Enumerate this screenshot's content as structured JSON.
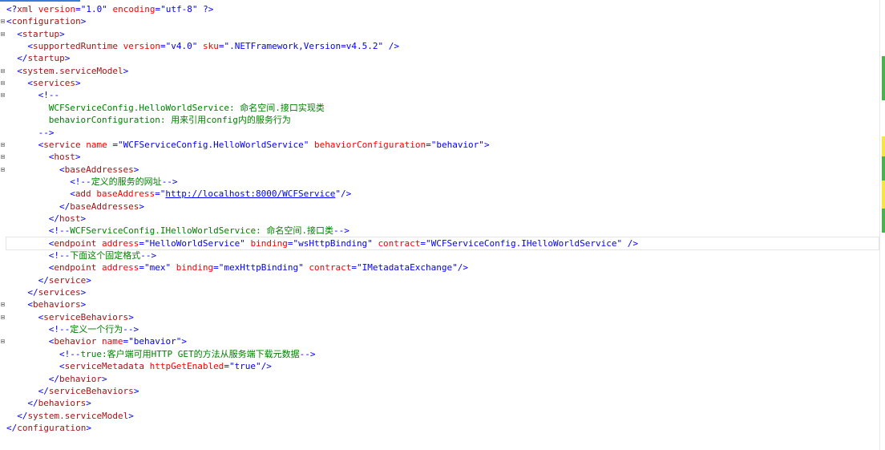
{
  "editor": {
    "language": "XML",
    "current_line": 20,
    "colors": {
      "bracket": "#0000ff",
      "element": "#a31515",
      "attribute": "#ff0000",
      "value": "#0000ff",
      "comment": "#008000",
      "change_mark_saved": "#4caf50",
      "change_mark_unsaved": "#f5e642"
    },
    "lines": [
      {
        "indent": 0,
        "fold": false,
        "tokens": [
          {
            "t": "bracket",
            "v": "<?"
          },
          {
            "t": "elem",
            "v": "xml"
          },
          {
            "t": "text",
            "v": " "
          },
          {
            "t": "attr",
            "v": "version"
          },
          {
            "t": "bracket",
            "v": "="
          },
          {
            "t": "val",
            "v": "\"1.0\""
          },
          {
            "t": "text",
            "v": " "
          },
          {
            "t": "attr",
            "v": "encoding"
          },
          {
            "t": "bracket",
            "v": "="
          },
          {
            "t": "val",
            "v": "\"utf-8\""
          },
          {
            "t": "text",
            "v": " "
          },
          {
            "t": "bracket",
            "v": "?>"
          }
        ]
      },
      {
        "indent": 0,
        "fold": true,
        "tokens": [
          {
            "t": "bracket",
            "v": "<"
          },
          {
            "t": "elem",
            "v": "configuration"
          },
          {
            "t": "bracket",
            "v": ">"
          }
        ]
      },
      {
        "indent": 1,
        "fold": true,
        "tokens": [
          {
            "t": "bracket",
            "v": "<"
          },
          {
            "t": "elem",
            "v": "startup"
          },
          {
            "t": "bracket",
            "v": ">"
          }
        ]
      },
      {
        "indent": 2,
        "fold": false,
        "tokens": [
          {
            "t": "bracket",
            "v": "<"
          },
          {
            "t": "elem",
            "v": "supportedRuntime"
          },
          {
            "t": "text",
            "v": " "
          },
          {
            "t": "attr",
            "v": "version"
          },
          {
            "t": "bracket",
            "v": "="
          },
          {
            "t": "val",
            "v": "\"v4.0\""
          },
          {
            "t": "text",
            "v": " "
          },
          {
            "t": "attr",
            "v": "sku"
          },
          {
            "t": "bracket",
            "v": "="
          },
          {
            "t": "val",
            "v": "\".NETFramework,Version=v4.5.2\""
          },
          {
            "t": "text",
            "v": " "
          },
          {
            "t": "bracket",
            "v": "/>"
          }
        ]
      },
      {
        "indent": 1,
        "fold": false,
        "tokens": [
          {
            "t": "bracket",
            "v": "</"
          },
          {
            "t": "elem",
            "v": "startup"
          },
          {
            "t": "bracket",
            "v": ">"
          }
        ]
      },
      {
        "indent": 1,
        "fold": true,
        "tokens": [
          {
            "t": "bracket",
            "v": "<"
          },
          {
            "t": "elem",
            "v": "system.serviceModel"
          },
          {
            "t": "bracket",
            "v": ">"
          }
        ]
      },
      {
        "indent": 2,
        "fold": true,
        "tokens": [
          {
            "t": "bracket",
            "v": "<"
          },
          {
            "t": "elem",
            "v": "services"
          },
          {
            "t": "bracket",
            "v": ">"
          }
        ]
      },
      {
        "indent": 3,
        "fold": true,
        "tokens": [
          {
            "t": "bracket",
            "v": "<!--"
          }
        ]
      },
      {
        "indent": 4,
        "fold": false,
        "tokens": [
          {
            "t": "com",
            "v": "WCFServiceConfig.HelloWorldService: 命名空间.接口实现类"
          }
        ]
      },
      {
        "indent": 4,
        "fold": false,
        "tokens": [
          {
            "t": "com",
            "v": "behaviorConfiguration: 用来引用config内的服务行为"
          }
        ]
      },
      {
        "indent": 3,
        "fold": false,
        "tokens": [
          {
            "t": "bracket",
            "v": "-->"
          }
        ]
      },
      {
        "indent": 3,
        "fold": true,
        "tokens": [
          {
            "t": "bracket",
            "v": "<"
          },
          {
            "t": "elem",
            "v": "service"
          },
          {
            "t": "text",
            "v": " "
          },
          {
            "t": "attr",
            "v": "name"
          },
          {
            "t": "text",
            "v": " "
          },
          {
            "t": "bracket",
            "v": "="
          },
          {
            "t": "val",
            "v": "\"WCFServiceConfig.HelloWorldService\""
          },
          {
            "t": "text",
            "v": " "
          },
          {
            "t": "attr",
            "v": "behaviorConfiguration"
          },
          {
            "t": "bracket",
            "v": "="
          },
          {
            "t": "val",
            "v": "\"behavior\""
          },
          {
            "t": "bracket",
            "v": ">"
          }
        ]
      },
      {
        "indent": 4,
        "fold": true,
        "tokens": [
          {
            "t": "bracket",
            "v": "<"
          },
          {
            "t": "elem",
            "v": "host"
          },
          {
            "t": "bracket",
            "v": ">"
          }
        ]
      },
      {
        "indent": 5,
        "fold": true,
        "tokens": [
          {
            "t": "bracket",
            "v": "<"
          },
          {
            "t": "elem",
            "v": "baseAddresses"
          },
          {
            "t": "bracket",
            "v": ">"
          }
        ]
      },
      {
        "indent": 6,
        "fold": false,
        "tokens": [
          {
            "t": "bracket",
            "v": "<!--"
          },
          {
            "t": "com",
            "v": "定义的服务的网址"
          },
          {
            "t": "bracket",
            "v": "-->"
          }
        ]
      },
      {
        "indent": 6,
        "fold": false,
        "tokens": [
          {
            "t": "bracket",
            "v": "<"
          },
          {
            "t": "elem",
            "v": "add"
          },
          {
            "t": "text",
            "v": " "
          },
          {
            "t": "attr",
            "v": "baseAddress"
          },
          {
            "t": "bracket",
            "v": "="
          },
          {
            "t": "val",
            "v": "\""
          },
          {
            "t": "link",
            "v": "http://localhost:8000/WCFService"
          },
          {
            "t": "val",
            "v": "\""
          },
          {
            "t": "bracket",
            "v": "/>"
          }
        ]
      },
      {
        "indent": 5,
        "fold": false,
        "tokens": [
          {
            "t": "bracket",
            "v": "</"
          },
          {
            "t": "elem",
            "v": "baseAddresses"
          },
          {
            "t": "bracket",
            "v": ">"
          }
        ]
      },
      {
        "indent": 4,
        "fold": false,
        "tokens": [
          {
            "t": "bracket",
            "v": "</"
          },
          {
            "t": "elem",
            "v": "host"
          },
          {
            "t": "bracket",
            "v": ">"
          }
        ]
      },
      {
        "indent": 4,
        "fold": false,
        "tokens": [
          {
            "t": "bracket",
            "v": "<!--"
          },
          {
            "t": "com",
            "v": "WCFServiceConfig.IHelloWorldService: 命名空间.接口类"
          },
          {
            "t": "bracket",
            "v": "-->"
          }
        ]
      },
      {
        "indent": 4,
        "fold": false,
        "tokens": [
          {
            "t": "bracket",
            "v": "<"
          },
          {
            "t": "elem",
            "v": "endpoint"
          },
          {
            "t": "text",
            "v": " "
          },
          {
            "t": "attr",
            "v": "address"
          },
          {
            "t": "bracket",
            "v": "="
          },
          {
            "t": "val",
            "v": "\"HelloWorldService\""
          },
          {
            "t": "text",
            "v": " "
          },
          {
            "t": "attr",
            "v": "binding"
          },
          {
            "t": "bracket",
            "v": "="
          },
          {
            "t": "val",
            "v": "\"wsHttpBinding\""
          },
          {
            "t": "text",
            "v": " "
          },
          {
            "t": "attr",
            "v": "contract"
          },
          {
            "t": "bracket",
            "v": "="
          },
          {
            "t": "val",
            "v": "\"WCFServiceConfig.IHelloWorldService\""
          },
          {
            "t": "text",
            "v": " "
          },
          {
            "t": "bracket",
            "v": "/>"
          }
        ]
      },
      {
        "indent": 4,
        "fold": false,
        "tokens": [
          {
            "t": "bracket",
            "v": "<!--"
          },
          {
            "t": "com",
            "v": "下面这个固定格式"
          },
          {
            "t": "bracket",
            "v": "-->"
          }
        ]
      },
      {
        "indent": 4,
        "fold": false,
        "tokens": [
          {
            "t": "bracket",
            "v": "<"
          },
          {
            "t": "elem",
            "v": "endpoint"
          },
          {
            "t": "text",
            "v": " "
          },
          {
            "t": "attr",
            "v": "address"
          },
          {
            "t": "bracket",
            "v": "="
          },
          {
            "t": "val",
            "v": "\"mex\""
          },
          {
            "t": "text",
            "v": " "
          },
          {
            "t": "attr",
            "v": "binding"
          },
          {
            "t": "bracket",
            "v": "="
          },
          {
            "t": "val",
            "v": "\"mexHttpBinding\""
          },
          {
            "t": "text",
            "v": " "
          },
          {
            "t": "attr",
            "v": "contract"
          },
          {
            "t": "bracket",
            "v": "="
          },
          {
            "t": "val",
            "v": "\"IMetadataExchange\""
          },
          {
            "t": "bracket",
            "v": "/>"
          }
        ]
      },
      {
        "indent": 3,
        "fold": false,
        "tokens": [
          {
            "t": "bracket",
            "v": "</"
          },
          {
            "t": "elem",
            "v": "service"
          },
          {
            "t": "bracket",
            "v": ">"
          }
        ]
      },
      {
        "indent": 2,
        "fold": false,
        "tokens": [
          {
            "t": "bracket",
            "v": "</"
          },
          {
            "t": "elem",
            "v": "services"
          },
          {
            "t": "bracket",
            "v": ">"
          }
        ]
      },
      {
        "indent": 2,
        "fold": true,
        "tokens": [
          {
            "t": "bracket",
            "v": "<"
          },
          {
            "t": "elem",
            "v": "behaviors"
          },
          {
            "t": "bracket",
            "v": ">"
          }
        ]
      },
      {
        "indent": 3,
        "fold": true,
        "tokens": [
          {
            "t": "bracket",
            "v": "<"
          },
          {
            "t": "elem",
            "v": "serviceBehaviors"
          },
          {
            "t": "bracket",
            "v": ">"
          }
        ]
      },
      {
        "indent": 4,
        "fold": false,
        "tokens": [
          {
            "t": "bracket",
            "v": "<!--"
          },
          {
            "t": "com",
            "v": "定义一个行为"
          },
          {
            "t": "bracket",
            "v": "-->"
          }
        ]
      },
      {
        "indent": 4,
        "fold": true,
        "tokens": [
          {
            "t": "bracket",
            "v": "<"
          },
          {
            "t": "elem",
            "v": "behavior"
          },
          {
            "t": "text",
            "v": " "
          },
          {
            "t": "attr",
            "v": "name"
          },
          {
            "t": "bracket",
            "v": "="
          },
          {
            "t": "val",
            "v": "\"behavior\""
          },
          {
            "t": "bracket",
            "v": ">"
          }
        ]
      },
      {
        "indent": 5,
        "fold": false,
        "tokens": [
          {
            "t": "bracket",
            "v": "<!--"
          },
          {
            "t": "com",
            "v": "true:客户端可用HTTP GET的方法从服务端下载元数据"
          },
          {
            "t": "bracket",
            "v": "-->"
          }
        ]
      },
      {
        "indent": 5,
        "fold": false,
        "tokens": [
          {
            "t": "bracket",
            "v": "<"
          },
          {
            "t": "elem",
            "v": "serviceMetadata"
          },
          {
            "t": "text",
            "v": " "
          },
          {
            "t": "attr",
            "v": "httpGetEnabled"
          },
          {
            "t": "bracket",
            "v": "="
          },
          {
            "t": "val",
            "v": "\"true\""
          },
          {
            "t": "bracket",
            "v": "/>"
          }
        ]
      },
      {
        "indent": 4,
        "fold": false,
        "tokens": [
          {
            "t": "bracket",
            "v": "</"
          },
          {
            "t": "elem",
            "v": "behavior"
          },
          {
            "t": "bracket",
            "v": ">"
          }
        ]
      },
      {
        "indent": 3,
        "fold": false,
        "tokens": [
          {
            "t": "bracket",
            "v": "</"
          },
          {
            "t": "elem",
            "v": "serviceBehaviors"
          },
          {
            "t": "bracket",
            "v": ">"
          }
        ]
      },
      {
        "indent": 2,
        "fold": false,
        "tokens": [
          {
            "t": "bracket",
            "v": "</"
          },
          {
            "t": "elem",
            "v": "behaviors"
          },
          {
            "t": "bracket",
            "v": ">"
          }
        ]
      },
      {
        "indent": 1,
        "fold": false,
        "tokens": [
          {
            "t": "bracket",
            "v": "</"
          },
          {
            "t": "elem",
            "v": "system.serviceModel"
          },
          {
            "t": "bracket",
            "v": ">"
          }
        ]
      },
      {
        "indent": 0,
        "fold": false,
        "tokens": [
          {
            "t": "bracket",
            "v": "</"
          },
          {
            "t": "elem",
            "v": "configuration"
          },
          {
            "t": "bracket",
            "v": ">"
          }
        ]
      }
    ]
  }
}
